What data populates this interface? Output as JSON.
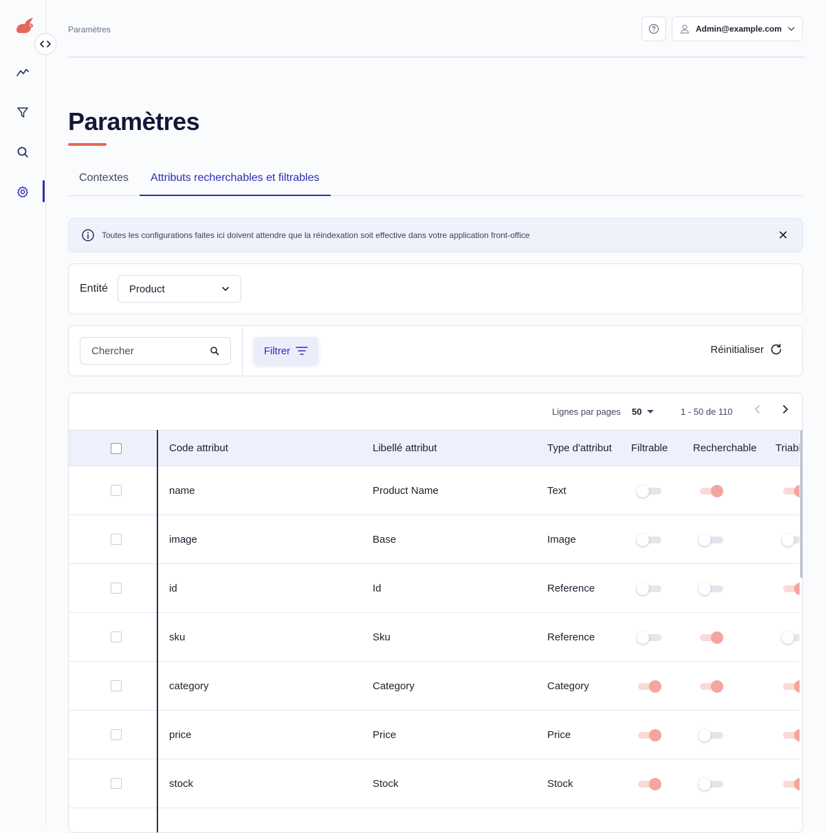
{
  "breadcrumb": "Paramètres",
  "header": {
    "user_email": "Admin@example.com"
  },
  "page": {
    "title": "Paramètres"
  },
  "tabs": [
    {
      "label": "Contextes",
      "active": false
    },
    {
      "label": "Attributs recherchables et filtrables",
      "active": true
    }
  ],
  "banner": {
    "text": "Toutes les configurations faites ici doivent attendre que la réindexation soit effective dans votre application front-office"
  },
  "entity": {
    "label": "Entité",
    "selected": "Product"
  },
  "filters": {
    "search_placeholder": "Chercher",
    "filter_label": "Filtrer",
    "reset_label": "Réinitialiser"
  },
  "pager": {
    "rows_per_page_label": "Lignes par pages",
    "rows_per_page": "50",
    "range": "1 - 50 de 110"
  },
  "table": {
    "headers": {
      "code": "Code attribut",
      "label": "Libellé attribut",
      "type": "Type d'attribut",
      "filterable": "Filtrable",
      "searchable": "Recherchable",
      "sortable": "Triabl"
    },
    "rows": [
      {
        "code": "name",
        "label": "Product Name",
        "type": "Text",
        "filterable": false,
        "searchable": true,
        "sortable": true
      },
      {
        "code": "image",
        "label": "Base",
        "type": "Image",
        "filterable": false,
        "searchable": false,
        "sortable": false
      },
      {
        "code": "id",
        "label": "Id",
        "type": "Reference",
        "filterable": false,
        "searchable": false,
        "sortable": true
      },
      {
        "code": "sku",
        "label": "Sku",
        "type": "Reference",
        "filterable": false,
        "searchable": true,
        "sortable": false
      },
      {
        "code": "category",
        "label": "Category",
        "type": "Category",
        "filterable": true,
        "searchable": true,
        "sortable": true
      },
      {
        "code": "price",
        "label": "Price",
        "type": "Price",
        "filterable": true,
        "searchable": false,
        "sortable": true
      },
      {
        "code": "stock",
        "label": "Stock",
        "type": "Stock",
        "filterable": true,
        "searchable": false,
        "sortable": true
      }
    ]
  },
  "colors": {
    "accent": "#2d2bb5",
    "brand": "#e5675a",
    "toggle_on": "#f2a6a0"
  }
}
